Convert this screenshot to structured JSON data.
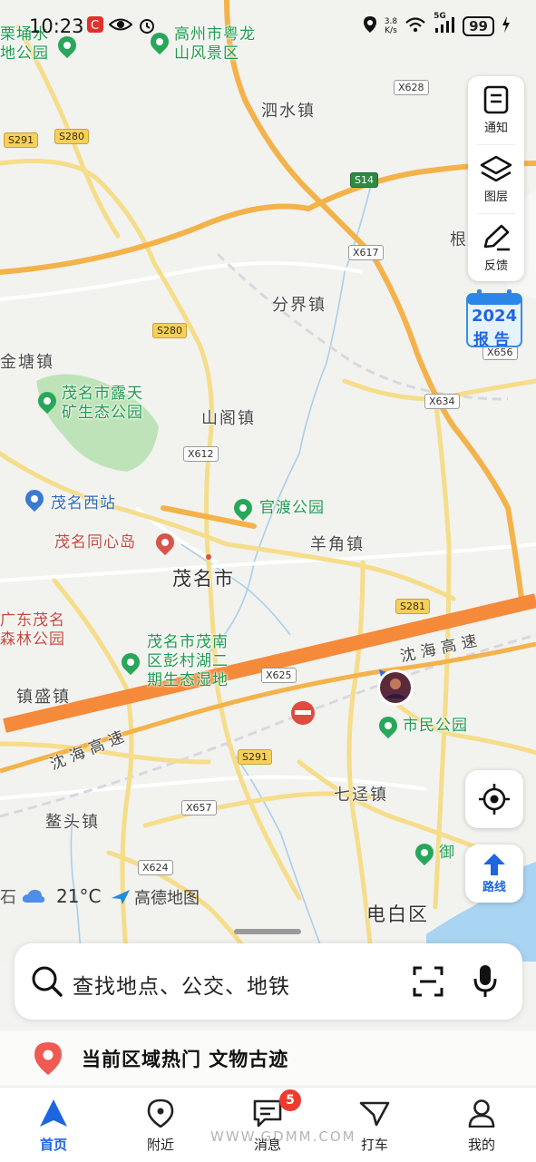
{
  "status_bar": {
    "time": "10:23",
    "net_speed_value": "3.8",
    "net_speed_unit": "K/s",
    "network": "5G",
    "battery": "99"
  },
  "map": {
    "places": {
      "gaozhou_scenic": "高州市粤龙\n山风景区",
      "top_left_park": "栗埇水\n地公园",
      "sishui": "泗水镇",
      "fenjie": "分界镇",
      "jintang": "金塘镇",
      "open_pit_park": "茂名市露天\n矿生态公园",
      "shange": "山阁镇",
      "maoming_west": "茂名西站",
      "guandu_park": "官渡公园",
      "tongxin_island": "茂名同心岛",
      "yangjiao": "羊角镇",
      "maoming_city": "茂名市",
      "forest_park": "广东茂名\n森林公园",
      "pengcun_lake": "茂名市茂南\n区彭村湖二\n期生态湿地",
      "zhensheng": "镇盛镇",
      "citizen_park": "市民公园",
      "qijing": "七迳镇",
      "aotou": "鳌头镇",
      "yu_park": "御",
      "dianbai": "电白区",
      "gen": "根"
    },
    "roads": {
      "expressway_upper": "沈海高速",
      "expressway_lower": "沈海高速"
    },
    "shields": {
      "x628": "X628",
      "s291_top": "S291",
      "s280_top": "S280",
      "s14": "S14",
      "x617": "X617",
      "s280_mid": "S280",
      "x656": "X656",
      "x634": "X634",
      "x612": "X612",
      "s281": "S281",
      "x625": "X625",
      "s291_bot": "S291",
      "x657": "X657",
      "x624": "X624"
    },
    "weather": {
      "temp": "21°C"
    },
    "map_logo": "高德地图"
  },
  "right_controls": {
    "notify": "通知",
    "layers": "图层",
    "feedback": "反馈",
    "report_year": "2024",
    "report_word": "报 告",
    "route": "路线"
  },
  "search": {
    "placeholder": "查找地点、公交、地铁"
  },
  "hot_line": "当前区域热门 文物古迹",
  "tabs": [
    {
      "label": "首页"
    },
    {
      "label": "附近"
    },
    {
      "label": "消息"
    },
    {
      "label": "打车"
    },
    {
      "label": "我的"
    }
  ],
  "message_badge": "5",
  "watermark": "WWW.GDMM.COM",
  "colors": {
    "accent": "#1d66e0",
    "expressway": "#f58a3a",
    "park_green": "#28a65a",
    "badge_red": "#ef3b2f"
  }
}
